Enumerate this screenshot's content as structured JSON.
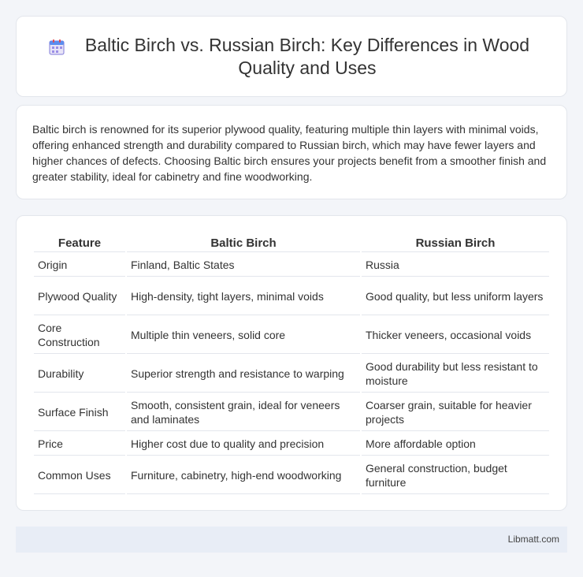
{
  "header": {
    "title": "Baltic Birch vs. Russian Birch: Key Differences in Wood Quality and Uses",
    "icon": "calendar-icon"
  },
  "summary": "Baltic birch is renowned for its superior plywood quality, featuring multiple thin layers with minimal voids, offering enhanced strength and durability compared to Russian birch, which may have fewer layers and higher chances of defects. Choosing Baltic birch ensures your projects benefit from a smoother finish and greater stability, ideal for cabinetry and fine woodworking.",
  "table": {
    "headers": [
      "Feature",
      "Baltic Birch",
      "Russian Birch"
    ],
    "rows": [
      [
        "Origin",
        "Finland, Baltic States",
        "Russia"
      ],
      [
        "Plywood Quality",
        "High-density, tight layers, minimal voids",
        "Good quality, but less uniform layers"
      ],
      [
        "Core Construction",
        "Multiple thin veneers, solid core",
        "Thicker veneers, occasional voids"
      ],
      [
        "Durability",
        "Superior strength and resistance to warping",
        "Good durability but less resistant to moisture"
      ],
      [
        "Surface Finish",
        "Smooth, consistent grain, ideal for veneers and laminates",
        "Coarser grain, suitable for heavier projects"
      ],
      [
        "Price",
        "Higher cost due to quality and precision",
        "More affordable option"
      ],
      [
        "Common Uses",
        "Furniture, cabinetry, high-end woodworking",
        "General construction, budget furniture"
      ]
    ]
  },
  "footer": {
    "site": "Libmatt.com"
  }
}
